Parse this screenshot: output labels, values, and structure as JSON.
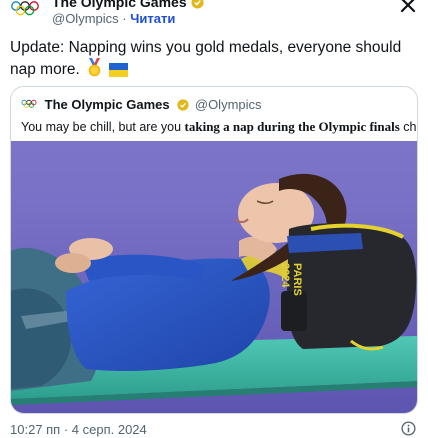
{
  "author": {
    "name": "The Olympic Games",
    "handle": "@Olympics",
    "separator": "·",
    "translate_label": "Читати"
  },
  "icons": {
    "logo": "olympic-rings-icon",
    "verified": "verified-badge-icon",
    "close": "close-icon",
    "info": "info-icon",
    "medal": "gold-medal-emoji",
    "flag": "ukraine-flag-emoji"
  },
  "tweet": {
    "text": "Update: Napping wins you gold medals, everyone should nap more."
  },
  "quote": {
    "name": "The Olympic Games",
    "handle": "@Olympics",
    "text_before": "You may be chill, but are you ",
    "text_emphasis": "taking a nap during the Olympic finals",
    "text_after": " chill?",
    "image_bag_text_1": "PARIS",
    "image_bag_text_2": "2024"
  },
  "footer": {
    "timestamp": "10:27 пп · 4 серп. 2024"
  },
  "colors": {
    "verified_gold": "#e2b719",
    "link_blue": "#1d4ed8",
    "muted": "#536471",
    "border": "#cfd9de",
    "track_purple": "#6a62ba",
    "mat_teal": "#3fb8a6",
    "jersey_blue": "#2c56c8",
    "jersey_yellow": "#e6d22e"
  }
}
